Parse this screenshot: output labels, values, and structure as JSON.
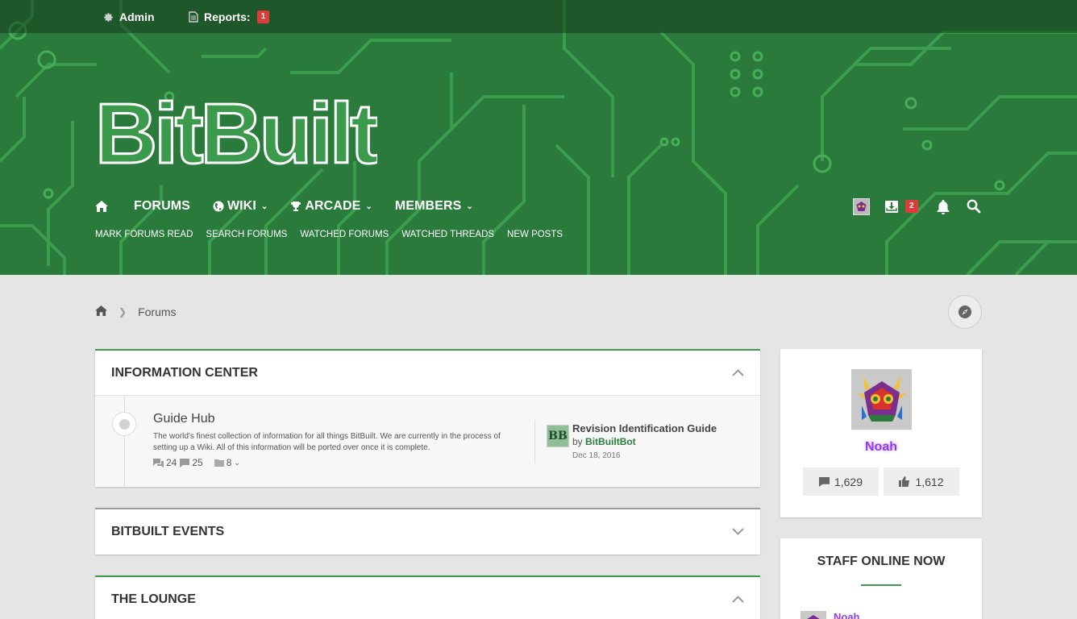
{
  "topbar": {
    "admin_label": "Admin",
    "reports_label": "Reports:",
    "reports_count": "1"
  },
  "logo": {
    "text": "BitBuilt"
  },
  "nav": {
    "home_icon": "home-icon",
    "items": [
      {
        "label": "FORUMS",
        "icon": "",
        "dropdown": false
      },
      {
        "label": "WIKI",
        "icon": "globe-icon",
        "dropdown": true
      },
      {
        "label": "ARCADE",
        "icon": "trophy-icon",
        "dropdown": true
      },
      {
        "label": "MEMBERS",
        "icon": "",
        "dropdown": true
      }
    ],
    "sub_items": [
      "MARK FORUMS READ",
      "SEARCH FORUMS",
      "WATCHED FORUMS",
      "WATCHED THREADS",
      "NEW POSTS"
    ]
  },
  "user_actions": {
    "inbox_count": "2",
    "icons": [
      "avatar",
      "inbox-icon",
      "bell-icon",
      "search-icon"
    ]
  },
  "breadcrumb": {
    "current": "Forums"
  },
  "colors": {
    "header_green": "#2a7a3b",
    "accent_green": "#3d9a4e",
    "username_purple": "#8f3cf2",
    "badge_red": "#e03a3a"
  },
  "categories": [
    {
      "title": "INFORMATION CENTER",
      "expanded": true,
      "nodes": [
        {
          "title": "Guide Hub",
          "description": "The world's finest collection of information for all things BitBuilt. We are currently in the process of setting up a Wiki. All of this information will be ported over once it is complete.",
          "threads": "24",
          "messages": "25",
          "subforums": "8",
          "latest": {
            "title": "Revision Identification Guide",
            "by_prefix": "by",
            "author": "BitBuiltBot",
            "date": "Dec 18, 2016",
            "avatar_text": "BB"
          }
        }
      ]
    },
    {
      "title": "BITBUILT EVENTS",
      "expanded": false
    },
    {
      "title": "THE LOUNGE",
      "expanded": true
    }
  ],
  "sidebar": {
    "profile": {
      "name": "Noah",
      "messages": "1,629",
      "reactions": "1,612"
    },
    "staff_online": {
      "heading": "STAFF ONLINE NOW",
      "members": [
        "Noah"
      ]
    }
  }
}
